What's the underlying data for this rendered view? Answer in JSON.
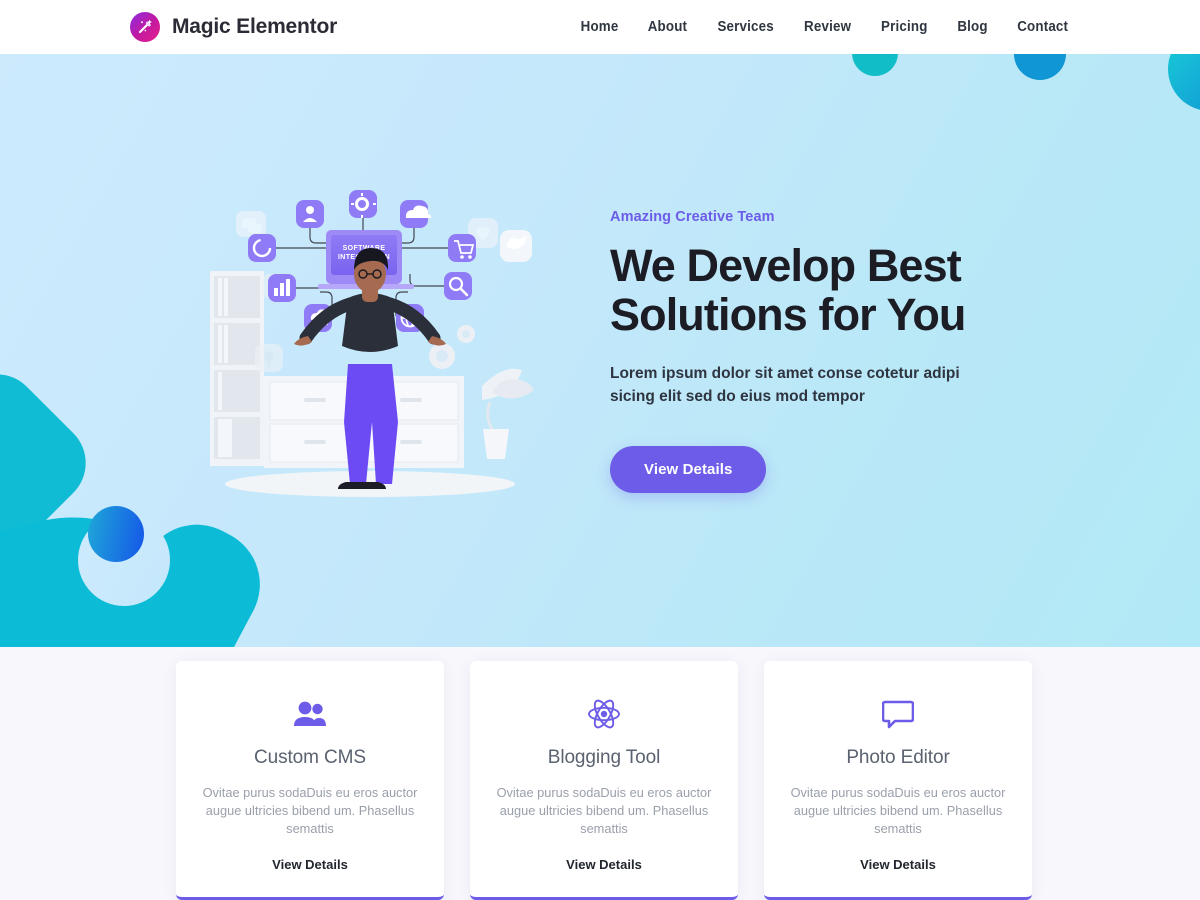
{
  "header": {
    "logo_icon": "magic-wand-sparkle-icon",
    "brand": "Magic Elementor",
    "nav": [
      {
        "label": "Home"
      },
      {
        "label": "About"
      },
      {
        "label": "Services"
      },
      {
        "label": "Review"
      },
      {
        "label": "Pricing"
      },
      {
        "label": "Blog"
      },
      {
        "label": "Contact"
      }
    ]
  },
  "hero": {
    "eyebrow": "Amazing Creative Team",
    "title_line1": "We Develop Best",
    "title_line2": "Solutions for You",
    "subtitle": "Lorem ipsum dolor sit amet conse cotetur adipi sicing elit sed do eius mod tempor",
    "cta": "View Details",
    "illustration": {
      "monitor_label_line1": "SOFTWARE",
      "monitor_label_line2": "INTEGRATION",
      "nodes": [
        "user-icon",
        "gear-icon",
        "cloud-icon",
        "loading-circle-icon",
        "shopping-cart-icon",
        "bar-chart-icon",
        "cloud-upload-icon",
        "globe-icon",
        "search-icon",
        "chat-icon",
        "twitter-icon",
        "location-pin-icon",
        "shield-icon"
      ]
    },
    "colors": {
      "accent": "#6c5ce7",
      "background": "#c5e8fb",
      "blob_teal": "#0cbcd6",
      "ball_blue": "#1556e8"
    }
  },
  "cards": [
    {
      "icon": "users-icon",
      "title": "Custom CMS",
      "text": "Ovitae purus sodaDuis eu eros auctor augue ultricies bibend um. Phasellus semattis",
      "link": "View Details"
    },
    {
      "icon": "react-atom-icon",
      "title": "Blogging Tool",
      "text": "Ovitae purus sodaDuis eu eros auctor augue ultricies bibend um. Phasellus semattis",
      "link": "View Details"
    },
    {
      "icon": "chat-bubble-icon",
      "title": "Photo Editor",
      "text": "Ovitae purus sodaDuis eu eros auctor augue ultricies bibend um. Phasellus semattis",
      "link": "View Details"
    }
  ]
}
